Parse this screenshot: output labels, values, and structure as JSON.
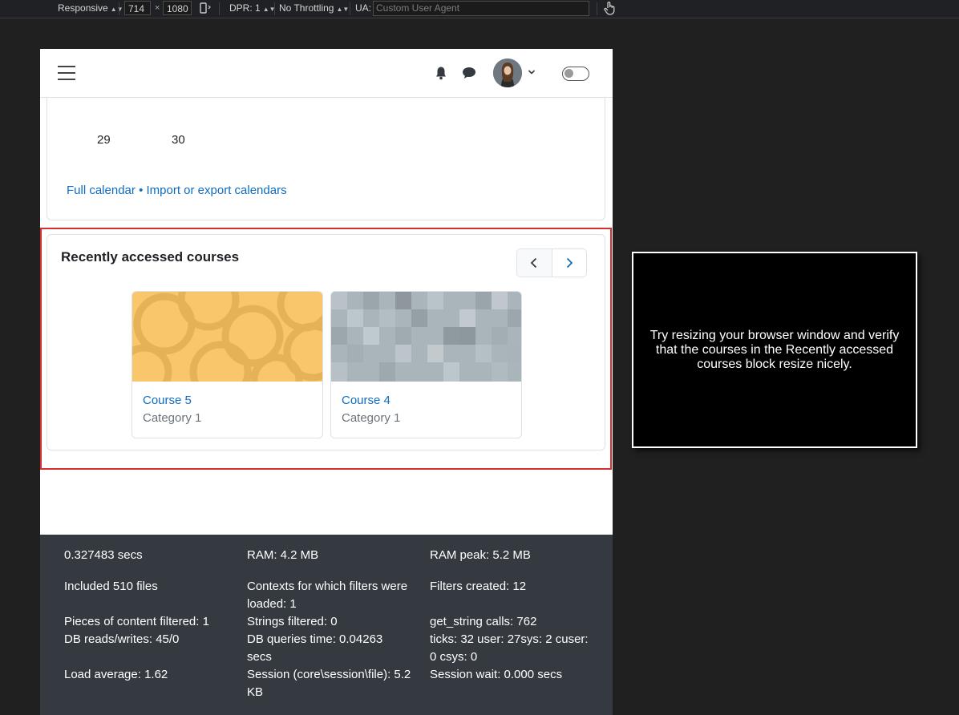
{
  "devtools": {
    "device": "Responsive",
    "width": "714",
    "times": "×",
    "height": "1080",
    "dpr": "DPR: 1",
    "throttling": "No Throttling",
    "ua_label": "UA:",
    "ua_placeholder": "Custom User Agent"
  },
  "navbar": {
    "icons": [
      "menu-icon",
      "bell-icon",
      "chat-icon",
      "user-avatar",
      "chevron-down-icon",
      "toggle-switch"
    ]
  },
  "calendar": {
    "days": [
      "29",
      "30"
    ],
    "full_calendar": "Full calendar",
    "bullet": "•",
    "import_export": "Import or export calendars"
  },
  "recent_courses": {
    "title": "Recently accessed courses",
    "courses": [
      {
        "name": "Course 5",
        "category": "Category 1"
      },
      {
        "name": "Course 4",
        "category": "Category 1"
      }
    ]
  },
  "footer": {
    "cells": [
      [
        "0.327483 secs",
        "RAM: 4.2 MB",
        "RAM peak: 5.2 MB"
      ],
      [
        "Included 510 files",
        "Contexts for which filters were loaded: 1",
        "Filters created: 12"
      ],
      [
        "Pieces of content filtered: 1",
        "Strings filtered: 0",
        "get_string calls: 762"
      ],
      [
        "DB reads/writes: 45/0",
        "DB queries time: 0.04263 secs",
        "ticks: 32 user: 27sys: 2 cuser: 0 csys: 0"
      ],
      [
        "Load average: 1.62",
        "Session (core\\session\\file): 5.2 KB",
        "Session wait: 0.000 secs"
      ]
    ]
  },
  "instruction": "Try resizing your browser window and verify that the courses in the Recently accessed courses block resize nicely.",
  "colors": {
    "link": "#0f6cbf",
    "footer_bg": "#343a40",
    "highlight": "#d32f2f",
    "course5_pattern": "#f9c66b",
    "course4_pattern": "#a9b4bb"
  }
}
